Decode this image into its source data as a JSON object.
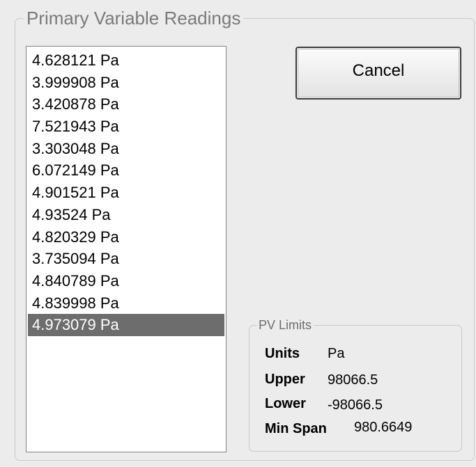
{
  "group": {
    "title": "Primary Variable Readings"
  },
  "readings": [
    "4.628121 Pa",
    "3.999908 Pa",
    "3.420878 Pa",
    "7.521943 Pa",
    "3.303048 Pa",
    "6.072149 Pa",
    "4.901521 Pa",
    "4.93524 Pa",
    "4.820329 Pa",
    "3.735094 Pa",
    "4.840789 Pa",
    "4.839998 Pa",
    "4.973079 Pa"
  ],
  "selected_reading": "4.973079 Pa",
  "buttons": {
    "cancel_label": "Cancel"
  },
  "pv_limits": {
    "title": "PV Limits",
    "units_label": "Units",
    "units_value": "Pa",
    "upper_label": "Upper",
    "upper_value": "98066.5",
    "lower_label": "Lower",
    "lower_value": "-98066.5",
    "min_span_label": "Min Span",
    "min_span_value": "980.6649"
  },
  "colors": {
    "background": "#ececec",
    "selection": "#6d6d6d",
    "group_title": "#7a7a7a"
  }
}
